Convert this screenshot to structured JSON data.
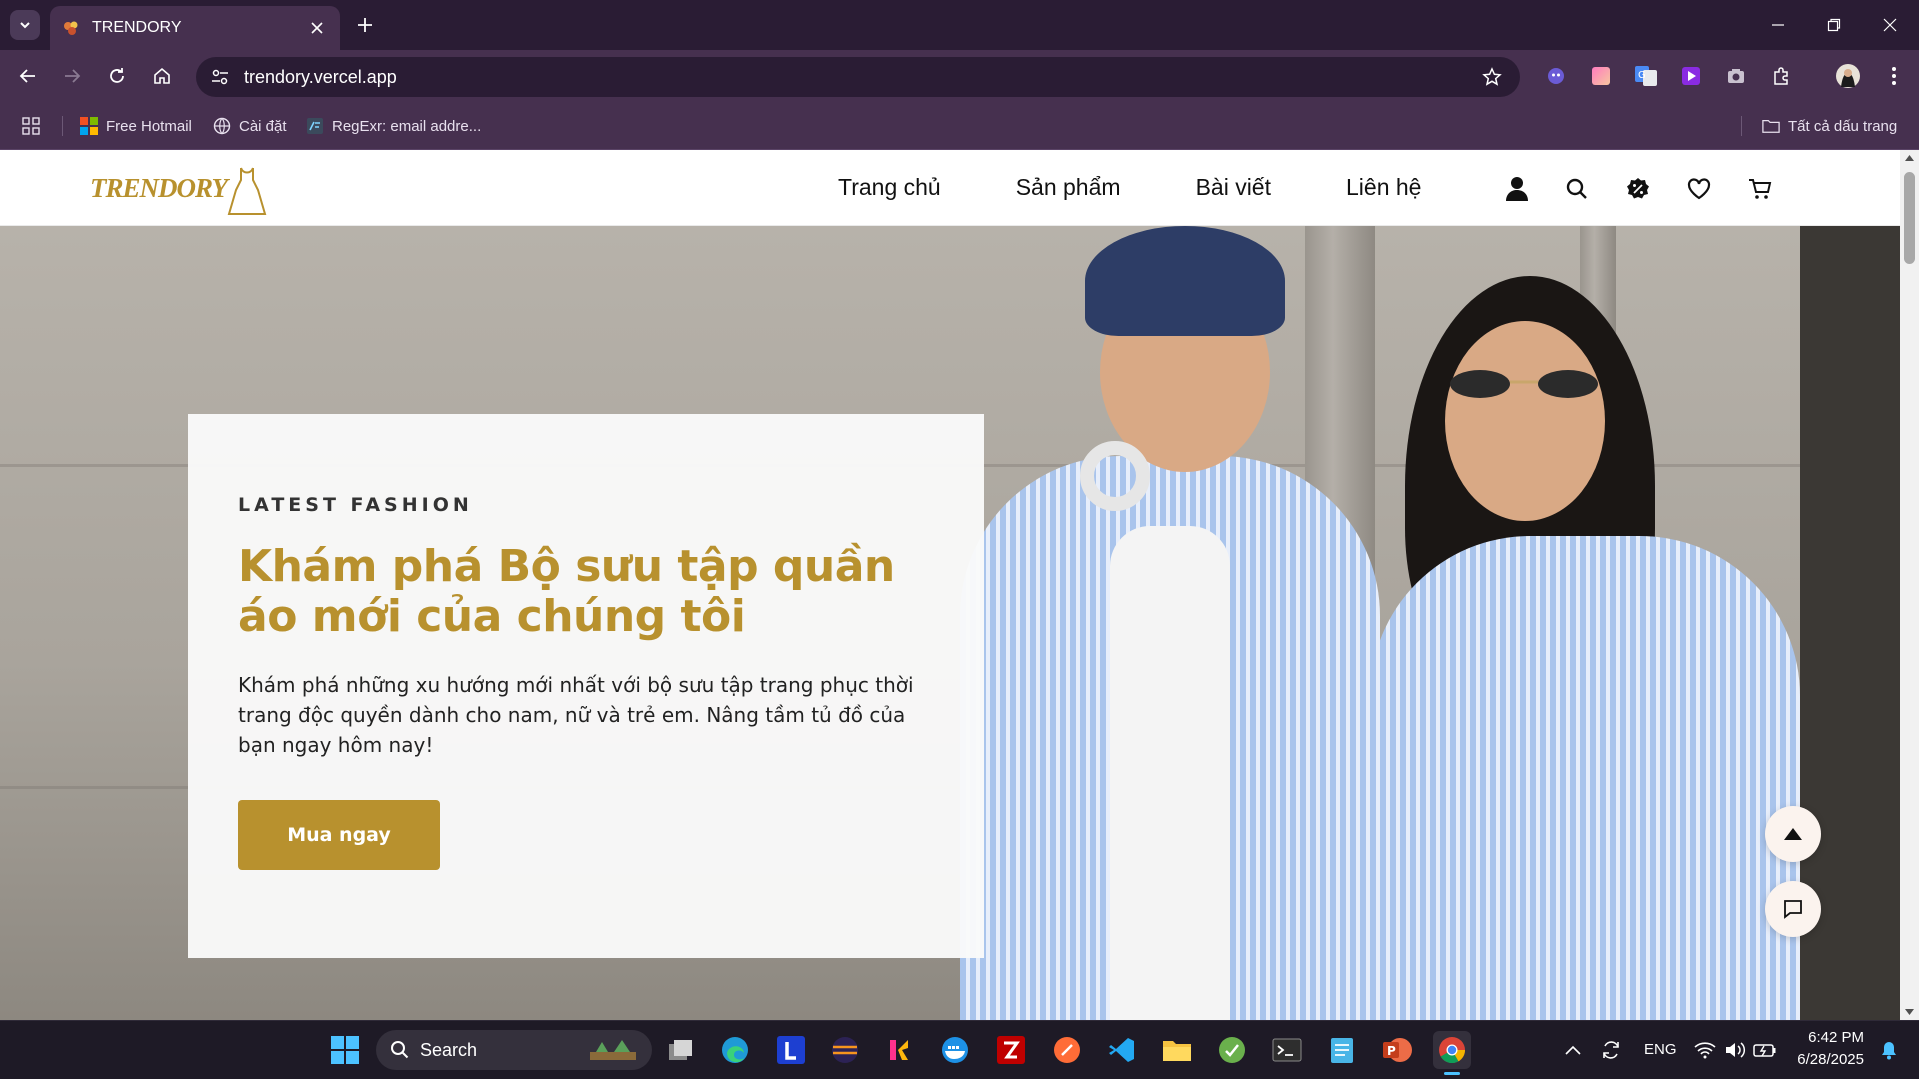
{
  "browser": {
    "tab": {
      "title": "TRENDORY"
    },
    "address_bar": {
      "url": "trendory.vercel.app"
    },
    "bookmarks": [
      {
        "label": "Free Hotmail"
      },
      {
        "label": "Cài đặt"
      },
      {
        "label": "RegExr: email addre..."
      }
    ],
    "all_bookmarks_label": "Tất cả dấu trang"
  },
  "site": {
    "logo": {
      "text": "TRENDORY"
    },
    "nav": {
      "home": "Trang chủ",
      "products": "Sản phẩm",
      "blog": "Bài viết",
      "contact": "Liên hệ"
    },
    "hero": {
      "eyebrow": "LATEST FASHION",
      "title": "Khám phá Bộ sưu tập quần áo mới của chúng tôi",
      "description": "Khám phá những xu hướng mới nhất với bộ sưu tập trang phục thời trang độc quyền dành cho nam, nữ và trẻ em. Nâng tầm tủ đồ của bạn ngay hôm nay!",
      "cta_label": "Mua ngay"
    }
  },
  "taskbar": {
    "search_label": "Search",
    "language": "ENG",
    "time": "6:42 PM",
    "date": "6/28/2025"
  },
  "colors": {
    "brand_gold": "#b8912e",
    "browser_frame": "#46304f",
    "taskbar": "#1e1a26"
  }
}
